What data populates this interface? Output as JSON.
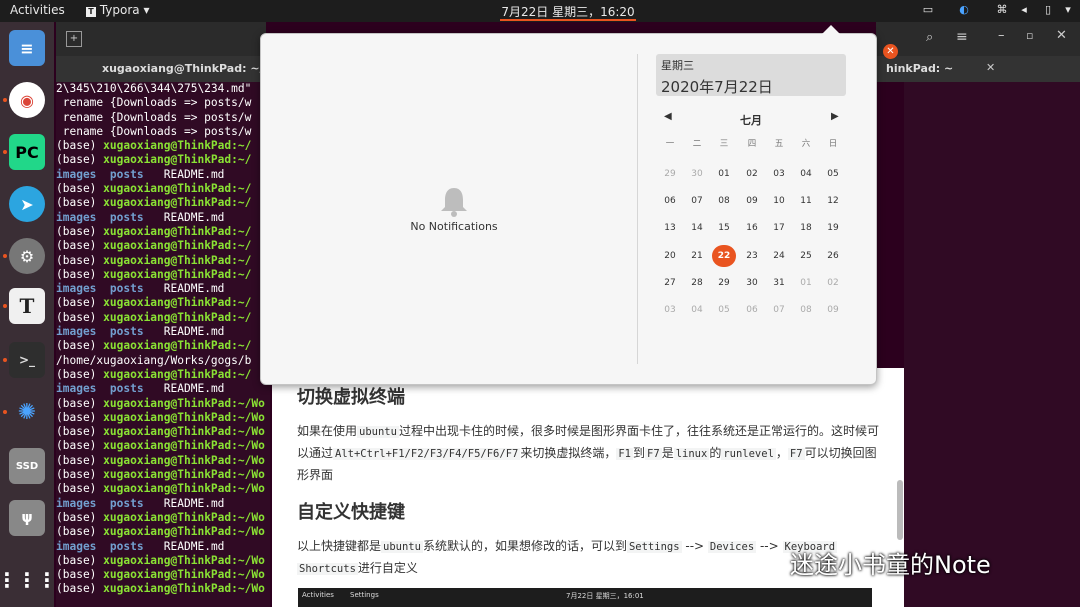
{
  "topbar": {
    "activities": "Activities",
    "app_name": "Typora",
    "clock": "7月22日 星期三，16:20"
  },
  "terminal": {
    "title": "xugaoxiang@ThinkPad: ~/Wo",
    "tab_right": "hinkPad: ~",
    "lines": [
      "2\\345\\210\\266\\344\\275\\234.md\"",
      " rename {Downloads => posts/w",
      " rename {Downloads => posts/w",
      " rename {Downloads => posts/w",
      "(base) xugaoxiang@ThinkPad:~/",
      "(base) xugaoxiang@ThinkPad:~/",
      "images  posts   README.md",
      "(base) xugaoxiang@ThinkPad:~/",
      "(base) xugaoxiang@ThinkPad:~/",
      "images  posts   README.md",
      "(base) xugaoxiang@ThinkPad:~/",
      "(base) xugaoxiang@ThinkPad:~/",
      "(base) xugaoxiang@ThinkPad:~/",
      "(base) xugaoxiang@ThinkPad:~/",
      "images  posts   README.md",
      "(base) xugaoxiang@ThinkPad:~/",
      "(base) xugaoxiang@ThinkPad:~/",
      "images  posts   README.md",
      "(base) xugaoxiang@ThinkPad:~/",
      "/home/xugaoxiang/Works/gogs/b",
      "(base) xugaoxiang@ThinkPad:~/",
      "images  posts   README.md",
      "(base) xugaoxiang@ThinkPad:~/Wo",
      "(base) xugaoxiang@ThinkPad:~/Wo",
      "(base) xugaoxiang@ThinkPad:~/Wo",
      "(base) xugaoxiang@ThinkPad:~/Wo",
      "(base) xugaoxiang@ThinkPad:~/Wo",
      "(base) xugaoxiang@ThinkPad:~/Wo",
      "(base) xugaoxiang@ThinkPad:~/Wo",
      "images  posts   README.md",
      "(base) xugaoxiang@ThinkPad:~/Wo",
      "(base) xugaoxiang@ThinkPad:~/Wo",
      "images  posts   README.md",
      "(base) xugaoxiang@ThinkPad:~/Wo",
      "(base) xugaoxiang@ThinkPad:~/Wo",
      "(base) xugaoxiang@ThinkPad:~/Wo"
    ]
  },
  "notifications": {
    "empty_text": "No Notifications"
  },
  "calendar": {
    "weekday": "星期三",
    "date": "2020年7月22日",
    "month": "七月",
    "prev": "◀",
    "next": "▶",
    "headers": [
      "一",
      "二",
      "三",
      "四",
      "五",
      "六",
      "日"
    ],
    "weeks": [
      [
        "29",
        "30",
        "01",
        "02",
        "03",
        "04",
        "05"
      ],
      [
        "06",
        "07",
        "08",
        "09",
        "10",
        "11",
        "12"
      ],
      [
        "13",
        "14",
        "15",
        "16",
        "17",
        "18",
        "19"
      ],
      [
        "20",
        "21",
        "22",
        "23",
        "24",
        "25",
        "26"
      ],
      [
        "27",
        "28",
        "29",
        "30",
        "31",
        "01",
        "02"
      ],
      [
        "03",
        "04",
        "05",
        "06",
        "07",
        "08",
        "09"
      ]
    ],
    "today_week": 3,
    "today_col": 2
  },
  "document": {
    "h_terminal": "切换虚拟终端",
    "p1_a": "如果在使用",
    "p1_code1": "ubuntu",
    "p1_b": "过程中出现卡住的时候，很多时候是图形界面卡住了，往往系统还是正常运行的。这时候可以通过",
    "p1_code2": "Alt+Ctrl+F1/F2/F3/F4/F5/F6/F7",
    "p1_c": "来切换虚拟终端，",
    "p1_code3": "F1",
    "p1_d": "到",
    "p1_code4": "F7",
    "p1_e": "是",
    "p1_code5": "linux",
    "p1_f": "的",
    "p1_code6": "runlevel",
    "p1_g": "，",
    "p1_code7": "F7",
    "p1_h": "可以切换回图形界面",
    "h_shortcut": "自定义快捷键",
    "p2_a": "以上快捷键都是",
    "p2_code1": "ubuntu",
    "p2_b": "系统默认的，如果想修改的话，可以到",
    "p2_code2": "Settings",
    "p2_c": " --> ",
    "p2_code3": "Devices",
    "p2_d": " --> ",
    "p2_code4": "Keyboard",
    "p2_e": " ",
    "p2_code5": "Shortcuts",
    "p2_f": "进行自定义"
  },
  "mini_screenshot": {
    "activities": "Activities",
    "settings": "Settings",
    "clock": "7月22日 星期三，16:01"
  },
  "watermark": "迷途小书童的Note",
  "colors": {
    "accent": "#e95420",
    "terminal_bg": "#300a24",
    "prompt_green": "#8ae234",
    "dir_blue": "#729fcf"
  }
}
